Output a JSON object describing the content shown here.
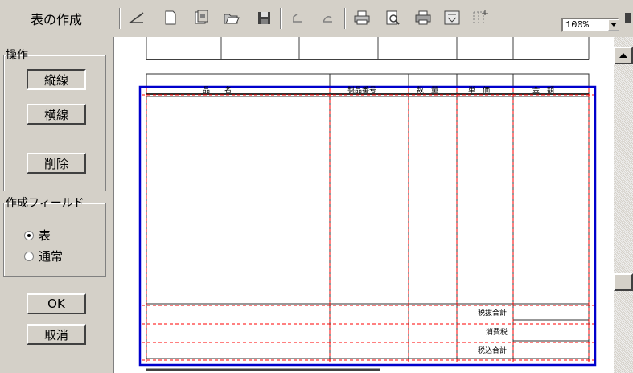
{
  "app": {
    "title": "表の作成"
  },
  "toolbar": {
    "icons": [
      "draw-line-icon",
      "new-document-icon",
      "template-icon",
      "open-folder-icon",
      "save-icon",
      "undo-icon",
      "redo-icon",
      "print-icon",
      "print-preview-icon",
      "printer-setup-icon",
      "form-icon",
      "grid-icon"
    ],
    "zoom_value": "100%"
  },
  "operations": {
    "legend": "操作",
    "vertical_line": "縦線",
    "horizontal_line": "横線",
    "delete": "削除"
  },
  "create_field": {
    "legend": "作成フィールド",
    "options": [
      {
        "label": "表",
        "selected": true
      },
      {
        "label": "通常",
        "selected": false
      }
    ]
  },
  "dialog": {
    "ok": "OK",
    "cancel": "取消"
  },
  "table": {
    "headers": [
      "品　　名",
      "製品番号",
      "数　量",
      "単　価",
      "金　額"
    ],
    "summary_labels": [
      "税抜合計",
      "消費税",
      "税込合計"
    ]
  },
  "colors": {
    "selection": "#0000cc",
    "guide": "#ff0000"
  }
}
